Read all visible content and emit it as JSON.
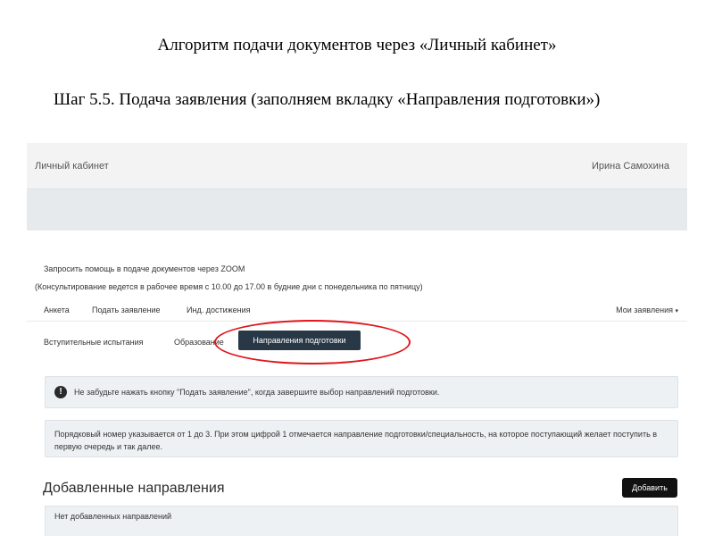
{
  "slide": {
    "title": "Алгоритм подачи документов через «Личный кабинет»",
    "subtitle": "Шаг 5.5. Подача заявления (заполняем вкладку «Направления подготовки»)"
  },
  "header": {
    "brand": "Личный кабинет",
    "user": "Ирина Самохина"
  },
  "help": {
    "zoom": "Запросить помощь в подаче документов через ZOOM",
    "hours": "(Консультирование ведется в рабочее время с 10.00 до 17.00 в будние дни с понедельника по пятницу)"
  },
  "nav": {
    "items": [
      "Анкета",
      "Подать заявление",
      "Инд. достижения"
    ],
    "my_applications": "Мои заявления",
    "caret": "▾"
  },
  "subnav": {
    "items": [
      "Вступительные испытания",
      "Образование"
    ],
    "active": "Направления подготовки"
  },
  "alert": {
    "icon": "!",
    "text": "Не забудьте нажать кнопку \"Подать заявление\", когда завершите выбор направлений подготовки."
  },
  "info": {
    "text": "Порядковый номер указывается от 1 до 3. При этом цифрой 1 отмечается направление подготовки/специальность, на которое поступающий желает поступить в первую очередь и так далее."
  },
  "directions": {
    "title": "Добавленные направления",
    "add_label": "Добавить",
    "empty": "Нет добавленных направлений"
  },
  "colors": {
    "active_tab": "#293846",
    "highlight": "#e0151b",
    "alert_bg": "#eef1f3"
  }
}
